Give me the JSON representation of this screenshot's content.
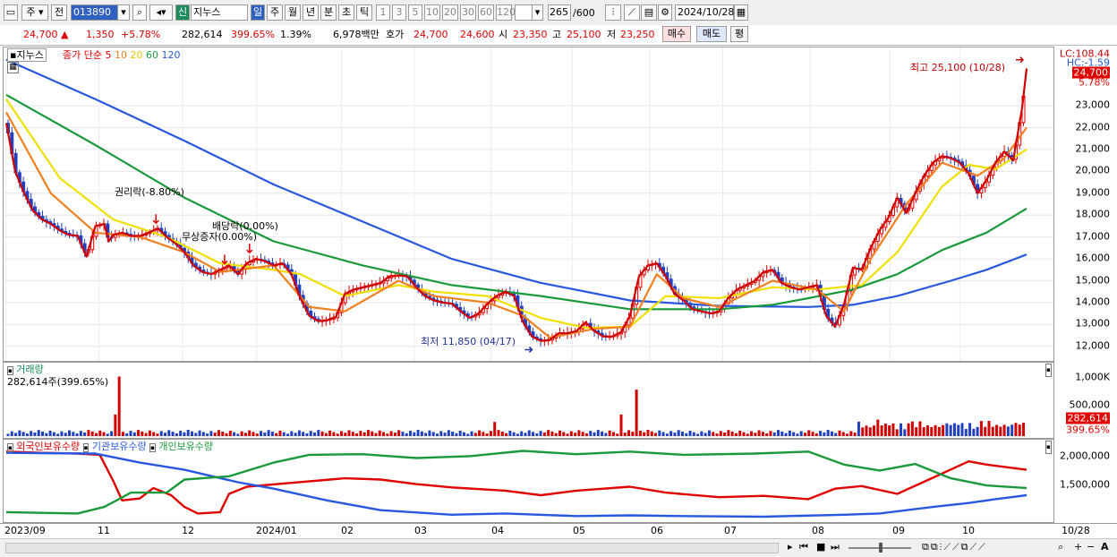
{
  "toolbar": {
    "market": "주",
    "prev": "전",
    "code": "013890",
    "sin": "신",
    "name": "지누스",
    "periods": [
      "일",
      "주",
      "월",
      "년",
      "분",
      "초",
      "틱"
    ],
    "intervals": [
      "1",
      "3",
      "5",
      "10",
      "20",
      "30",
      "60",
      "120"
    ],
    "count": "265",
    "count_total": "/600",
    "date": "2024/10/28"
  },
  "quote": {
    "price": "24,700",
    "change": "1,350",
    "change_pct": "+5.78%",
    "volume": "282,614",
    "volume_pct": "399.65%",
    "turnover": "1.39%",
    "amount": "6,978백만",
    "hoga_label": "호가",
    "ask": "24,700",
    "bid": "24,600",
    "open_label": "시",
    "open": "23,350",
    "high_label": "고",
    "high": "25,100",
    "low_label": "저",
    "low": "23,250",
    "buy": "매수",
    "sell": "매도",
    "avg": "평"
  },
  "price_pane": {
    "title": "지누스",
    "legend_label": "종가 단순",
    "ma": [
      {
        "period": "5",
        "color": "#e00000"
      },
      {
        "period": "10",
        "color": "#f08020"
      },
      {
        "period": "20",
        "color": "#e8c800"
      },
      {
        "period": "60",
        "color": "#1a9a3a"
      },
      {
        "period": "120",
        "color": "#2858e0"
      }
    ],
    "lc": "LC:108.44",
    "hc": "HC:-1.59",
    "cur": "24,700",
    "cur_pct": "5.78%",
    "high_note": "최고 25,100 (10/28)",
    "low_note": "최저 11,850 (04/17)",
    "events": [
      "권리락(-8.80%)",
      "무상증자(0.00%)",
      "배당락(0.00%)"
    ]
  },
  "volume_pane": {
    "title": "거래량",
    "value": "282,614주(399.65%)",
    "cur": "282,614",
    "cur_pct": "399.65%"
  },
  "holder_pane": {
    "series": [
      {
        "name": "외국인보유수량",
        "color": "#e00000"
      },
      {
        "name": "기관보유수량",
        "color": "#2858e0"
      },
      {
        "name": "개인보유수량",
        "color": "#1a9a3a"
      }
    ]
  },
  "chart_data": [
    {
      "type": "line",
      "title": "지누스",
      "x_months": [
        "2023/09",
        "11",
        "12",
        "2024/01",
        "02",
        "03",
        "04",
        "05",
        "06",
        "07",
        "08",
        "09",
        "10"
      ],
      "x_end": "10/28",
      "ylim": [
        11500,
        25500
      ],
      "yticks": [
        "12,000",
        "13,000",
        "14,000",
        "15,000",
        "16,000",
        "17,000",
        "18,000",
        "19,000",
        "20,000",
        "21,000",
        "22,000",
        "23,000"
      ],
      "close_points": [
        [
          0,
          22200
        ],
        [
          10,
          20000
        ],
        [
          20,
          19000
        ],
        [
          30,
          18200
        ],
        [
          40,
          17800
        ],
        [
          50,
          17600
        ],
        [
          60,
          17300
        ],
        [
          70,
          17100
        ],
        [
          80,
          17050
        ],
        [
          90,
          16100
        ],
        [
          100,
          17500
        ],
        [
          110,
          17600
        ],
        [
          115,
          16800
        ],
        [
          120,
          17100
        ],
        [
          130,
          17200
        ],
        [
          140,
          17050
        ],
        [
          150,
          17050
        ],
        [
          160,
          17200
        ],
        [
          170,
          17400
        ],
        [
          180,
          17000
        ],
        [
          190,
          16700
        ],
        [
          200,
          16300
        ],
        [
          210,
          15700
        ],
        [
          220,
          15400
        ],
        [
          230,
          15300
        ],
        [
          240,
          15500
        ],
        [
          250,
          15700
        ],
        [
          260,
          15300
        ],
        [
          270,
          15800
        ],
        [
          280,
          16000
        ],
        [
          290,
          15900
        ],
        [
          300,
          15700
        ],
        [
          310,
          15800
        ],
        [
          320,
          15300
        ],
        [
          330,
          14200
        ],
        [
          340,
          13400
        ],
        [
          350,
          13150
        ],
        [
          360,
          13200
        ],
        [
          370,
          13350
        ],
        [
          380,
          14400
        ],
        [
          390,
          14600
        ],
        [
          400,
          14700
        ],
        [
          410,
          14800
        ],
        [
          420,
          14900
        ],
        [
          430,
          15200
        ],
        [
          440,
          15250
        ],
        [
          450,
          15200
        ],
        [
          460,
          14700
        ],
        [
          470,
          14300
        ],
        [
          480,
          14100
        ],
        [
          490,
          14000
        ],
        [
          500,
          13950
        ],
        [
          510,
          13600
        ],
        [
          520,
          13300
        ],
        [
          530,
          13500
        ],
        [
          540,
          13950
        ],
        [
          550,
          14300
        ],
        [
          560,
          14500
        ],
        [
          570,
          14300
        ],
        [
          580,
          13100
        ],
        [
          590,
          12450
        ],
        [
          600,
          12250
        ],
        [
          610,
          12300
        ],
        [
          620,
          12600
        ],
        [
          630,
          12600
        ],
        [
          640,
          12700
        ],
        [
          650,
          13100
        ],
        [
          660,
          12700
        ],
        [
          670,
          12450
        ],
        [
          680,
          12450
        ],
        [
          690,
          12650
        ],
        [
          700,
          13400
        ],
        [
          710,
          15200
        ],
        [
          720,
          15700
        ],
        [
          730,
          15800
        ],
        [
          740,
          15200
        ],
        [
          750,
          14400
        ],
        [
          760,
          14100
        ],
        [
          770,
          13700
        ],
        [
          780,
          13600
        ],
        [
          790,
          13500
        ],
        [
          800,
          13600
        ],
        [
          810,
          14200
        ],
        [
          820,
          14600
        ],
        [
          830,
          14800
        ],
        [
          840,
          15000
        ],
        [
          850,
          15400
        ],
        [
          860,
          15500
        ],
        [
          870,
          14900
        ],
        [
          880,
          14700
        ],
        [
          890,
          14600
        ],
        [
          900,
          14700
        ],
        [
          910,
          14800
        ],
        [
          920,
          13400
        ],
        [
          930,
          12900
        ],
        [
          940,
          13900
        ],
        [
          950,
          15600
        ],
        [
          960,
          15500
        ],
        [
          970,
          16500
        ],
        [
          980,
          17300
        ],
        [
          990,
          17900
        ],
        [
          1000,
          18800
        ],
        [
          1010,
          18100
        ],
        [
          1020,
          19000
        ],
        [
          1030,
          19800
        ],
        [
          1040,
          20400
        ],
        [
          1050,
          20700
        ],
        [
          1060,
          20600
        ],
        [
          1070,
          20400
        ],
        [
          1080,
          19900
        ],
        [
          1090,
          19000
        ],
        [
          1100,
          19600
        ],
        [
          1110,
          20400
        ],
        [
          1120,
          20900
        ],
        [
          1130,
          20500
        ],
        [
          1140,
          22900
        ],
        [
          1145,
          24700
        ]
      ],
      "ma120_points": [
        [
          0,
          25100
        ],
        [
          100,
          23300
        ],
        [
          200,
          21400
        ],
        [
          300,
          19400
        ],
        [
          400,
          17700
        ],
        [
          500,
          16000
        ],
        [
          600,
          14900
        ],
        [
          700,
          14100
        ],
        [
          800,
          13850
        ],
        [
          900,
          13800
        ],
        [
          950,
          13900
        ],
        [
          1000,
          14300
        ],
        [
          1060,
          15000
        ],
        [
          1100,
          15500
        ],
        [
          1145,
          16200
        ]
      ],
      "ma60_points": [
        [
          0,
          23500
        ],
        [
          100,
          21200
        ],
        [
          200,
          18800
        ],
        [
          300,
          16800
        ],
        [
          400,
          15700
        ],
        [
          500,
          14800
        ],
        [
          600,
          14300
        ],
        [
          700,
          13700
        ],
        [
          800,
          13700
        ],
        [
          860,
          13900
        ],
        [
          900,
          14200
        ],
        [
          950,
          14600
        ],
        [
          1000,
          15300
        ],
        [
          1050,
          16400
        ],
        [
          1100,
          17200
        ],
        [
          1145,
          18300
        ]
      ],
      "ma20_points": [
        [
          0,
          23300
        ],
        [
          60,
          19700
        ],
        [
          120,
          17800
        ],
        [
          180,
          17000
        ],
        [
          240,
          15800
        ],
        [
          300,
          15500
        ],
        [
          330,
          15300
        ],
        [
          380,
          14300
        ],
        [
          440,
          14800
        ],
        [
          480,
          14500
        ],
        [
          540,
          14300
        ],
        [
          600,
          13300
        ],
        [
          650,
          12850
        ],
        [
          700,
          12900
        ],
        [
          740,
          14300
        ],
        [
          800,
          14200
        ],
        [
          860,
          14700
        ],
        [
          910,
          14600
        ],
        [
          960,
          14800
        ],
        [
          1000,
          16300
        ],
        [
          1050,
          19300
        ],
        [
          1080,
          20300
        ],
        [
          1110,
          20100
        ],
        [
          1145,
          21000
        ]
      ],
      "ma10_points": [
        [
          0,
          22700
        ],
        [
          50,
          19000
        ],
        [
          100,
          17200
        ],
        [
          150,
          17000
        ],
        [
          200,
          16300
        ],
        [
          240,
          15400
        ],
        [
          300,
          15700
        ],
        [
          340,
          13800
        ],
        [
          380,
          13600
        ],
        [
          440,
          15000
        ],
        [
          480,
          14300
        ],
        [
          540,
          14000
        ],
        [
          580,
          13400
        ],
        [
          610,
          12400
        ],
        [
          660,
          12800
        ],
        [
          700,
          12900
        ],
        [
          730,
          15300
        ],
        [
          760,
          14200
        ],
        [
          800,
          13800
        ],
        [
          860,
          15000
        ],
        [
          910,
          14600
        ],
        [
          940,
          13600
        ],
        [
          970,
          16000
        ],
        [
          1010,
          18500
        ],
        [
          1050,
          20400
        ],
        [
          1090,
          19800
        ],
        [
          1120,
          20600
        ],
        [
          1145,
          22000
        ]
      ]
    },
    {
      "type": "bar",
      "title": "거래량",
      "ylim": [
        0,
        1200000
      ],
      "yticks": [
        "1,000K",
        "500,000"
      ],
      "last": 282614
    },
    {
      "type": "line",
      "title": "보유수량",
      "ylim": [
        1300000,
        2150000
      ],
      "yticks": [
        "2,000,000",
        "1,500,000"
      ],
      "series": [
        {
          "name": "외국인보유수량",
          "points": [
            [
              0,
              2050000
            ],
            [
              40,
              2030000
            ],
            [
              80,
              2020000
            ],
            [
              105,
              2000000
            ],
            [
              120,
              1600000
            ],
            [
              130,
              1300000
            ],
            [
              150,
              1330000
            ],
            [
              165,
              1490000
            ],
            [
              185,
              1380000
            ],
            [
              200,
              1200000
            ],
            [
              215,
              1100000
            ],
            [
              240,
              1120000
            ],
            [
              250,
              1400000
            ],
            [
              270,
              1510000
            ],
            [
              320,
              1570000
            ],
            [
              380,
              1640000
            ],
            [
              420,
              1620000
            ],
            [
              460,
              1550000
            ],
            [
              500,
              1500000
            ],
            [
              560,
              1450000
            ],
            [
              600,
              1380000
            ],
            [
              640,
              1450000
            ],
            [
              700,
              1510000
            ],
            [
              740,
              1420000
            ],
            [
              800,
              1350000
            ],
            [
              850,
              1370000
            ],
            [
              900,
              1320000
            ],
            [
              930,
              1480000
            ],
            [
              960,
              1520000
            ],
            [
              1000,
              1400000
            ],
            [
              1040,
              1650000
            ],
            [
              1080,
              1900000
            ],
            [
              1100,
              1850000
            ],
            [
              1145,
              1770000
            ]
          ]
        },
        {
          "name": "기관보유수량",
          "points": [
            [
              0,
              2030000
            ],
            [
              100,
              2020000
            ],
            [
              150,
              1880000
            ],
            [
              200,
              1770000
            ],
            [
              260,
              1580000
            ],
            [
              300,
              1480000
            ],
            [
              360,
              1300000
            ],
            [
              420,
              1150000
            ],
            [
              500,
              1080000
            ],
            [
              560,
              1100000
            ],
            [
              640,
              1060000
            ],
            [
              700,
              1070000
            ],
            [
              760,
              1060000
            ],
            [
              850,
              1050000
            ],
            [
              940,
              1080000
            ],
            [
              980,
              1100000
            ],
            [
              1040,
              1200000
            ],
            [
              1080,
              1260000
            ],
            [
              1110,
              1320000
            ],
            [
              1145,
              1380000
            ]
          ]
        },
        {
          "name": "개인보유수량",
          "points": [
            [
              0,
              1120000
            ],
            [
              80,
              1100000
            ],
            [
              110,
              1200000
            ],
            [
              140,
              1420000
            ],
            [
              180,
              1420000
            ],
            [
              200,
              1620000
            ],
            [
              250,
              1670000
            ],
            [
              300,
              1880000
            ],
            [
              340,
              2000000
            ],
            [
              400,
              2010000
            ],
            [
              460,
              1950000
            ],
            [
              520,
              1980000
            ],
            [
              580,
              2060000
            ],
            [
              640,
              2010000
            ],
            [
              700,
              2050000
            ],
            [
              760,
              2000000
            ],
            [
              840,
              2020000
            ],
            [
              900,
              2050000
            ],
            [
              940,
              1850000
            ],
            [
              980,
              1760000
            ],
            [
              1020,
              1860000
            ],
            [
              1060,
              1640000
            ],
            [
              1100,
              1530000
            ],
            [
              1145,
              1490000
            ]
          ]
        }
      ]
    }
  ]
}
